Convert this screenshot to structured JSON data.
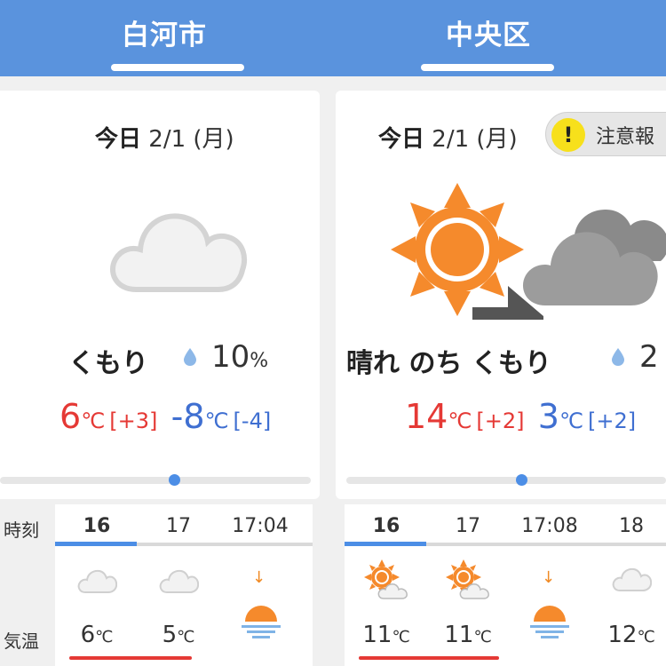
{
  "left": {
    "city": "白河市",
    "date_today": "今日",
    "date_rest": "2/1 (月)",
    "condition": "くもり",
    "rain": "10",
    "rain_unit": "%",
    "max": "6",
    "max_diff": "[+3]",
    "min": "-8",
    "min_diff": "[-4]",
    "unit": "℃",
    "time_label": "時刻",
    "temp_label": "気温",
    "hours": [
      "16",
      "17",
      "17:04"
    ],
    "hour_temps": [
      "6",
      "5"
    ],
    "hour_icons": [
      "cloud-icon",
      "cloud-icon",
      "sunset-icon"
    ]
  },
  "right": {
    "city": "中央区",
    "date_today": "今日",
    "date_rest": "2/1 (月)",
    "warning": "注意報",
    "condition": "晴れ のち くもり",
    "rain": "2",
    "max": "14",
    "max_diff": "[+2]",
    "min": "3",
    "min_diff": "[+2]",
    "unit": "℃",
    "hours": [
      "16",
      "17",
      "17:08",
      "18"
    ],
    "hour_temps": [
      "11",
      "11",
      "12"
    ],
    "hour_icons": [
      "sun-cloud-icon",
      "sun-cloud-icon",
      "sunset-icon",
      "cloud-icon"
    ]
  },
  "colors": {
    "header": "#5a93dd",
    "max_temp": "#e53935",
    "min_temp": "#3f6fd1",
    "sun": "#f58a2c",
    "warning": "#f7e01b"
  }
}
